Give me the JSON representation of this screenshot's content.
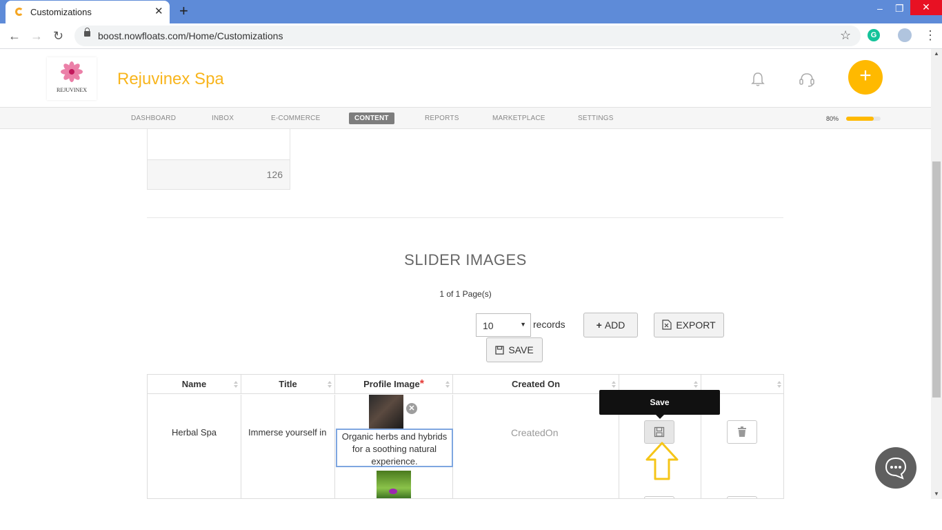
{
  "browser": {
    "tab_title": "Customizations",
    "url": "boost.nowfloats.com/Home/Customizations",
    "window_controls": [
      "–",
      "❐",
      "✕"
    ]
  },
  "header": {
    "logo_text": "REJUVINEX",
    "brand_name": "Rejuvinex Spa",
    "add_symbol": "+"
  },
  "nav": {
    "items": [
      "DASHBOARD",
      "INBOX",
      "E-COMMERCE",
      "CONTENT",
      "REPORTS",
      "MARKETPLACE",
      "SETTINGS"
    ],
    "active": "CONTENT",
    "progress_label": "80%",
    "progress_value": 0.8
  },
  "card": {
    "count": "126"
  },
  "section": {
    "title": "SLIDER IMAGES",
    "pager": "1 of 1 Page(s)",
    "records_select": "10",
    "records_label": "records",
    "add_label": "ADD",
    "export_label": "EXPORT",
    "save_label": "SAVE"
  },
  "table": {
    "headers": [
      "Name",
      "Title",
      "Profile Image",
      "Created On",
      "",
      ""
    ],
    "required_mark": "*",
    "rows": [
      {
        "name": "Herbal Spa",
        "title": "Immerse yourself in",
        "description": "Organic herbs and hybrids for a soothing natural experience.",
        "created_on": "CreatedOn"
      }
    ]
  },
  "tooltip": {
    "text": "Save"
  },
  "colors": {
    "accent": "#ffb900",
    "brand": "#f8b51d",
    "tab_bar": "#5e8bd8",
    "annotation": "#f5c518"
  }
}
